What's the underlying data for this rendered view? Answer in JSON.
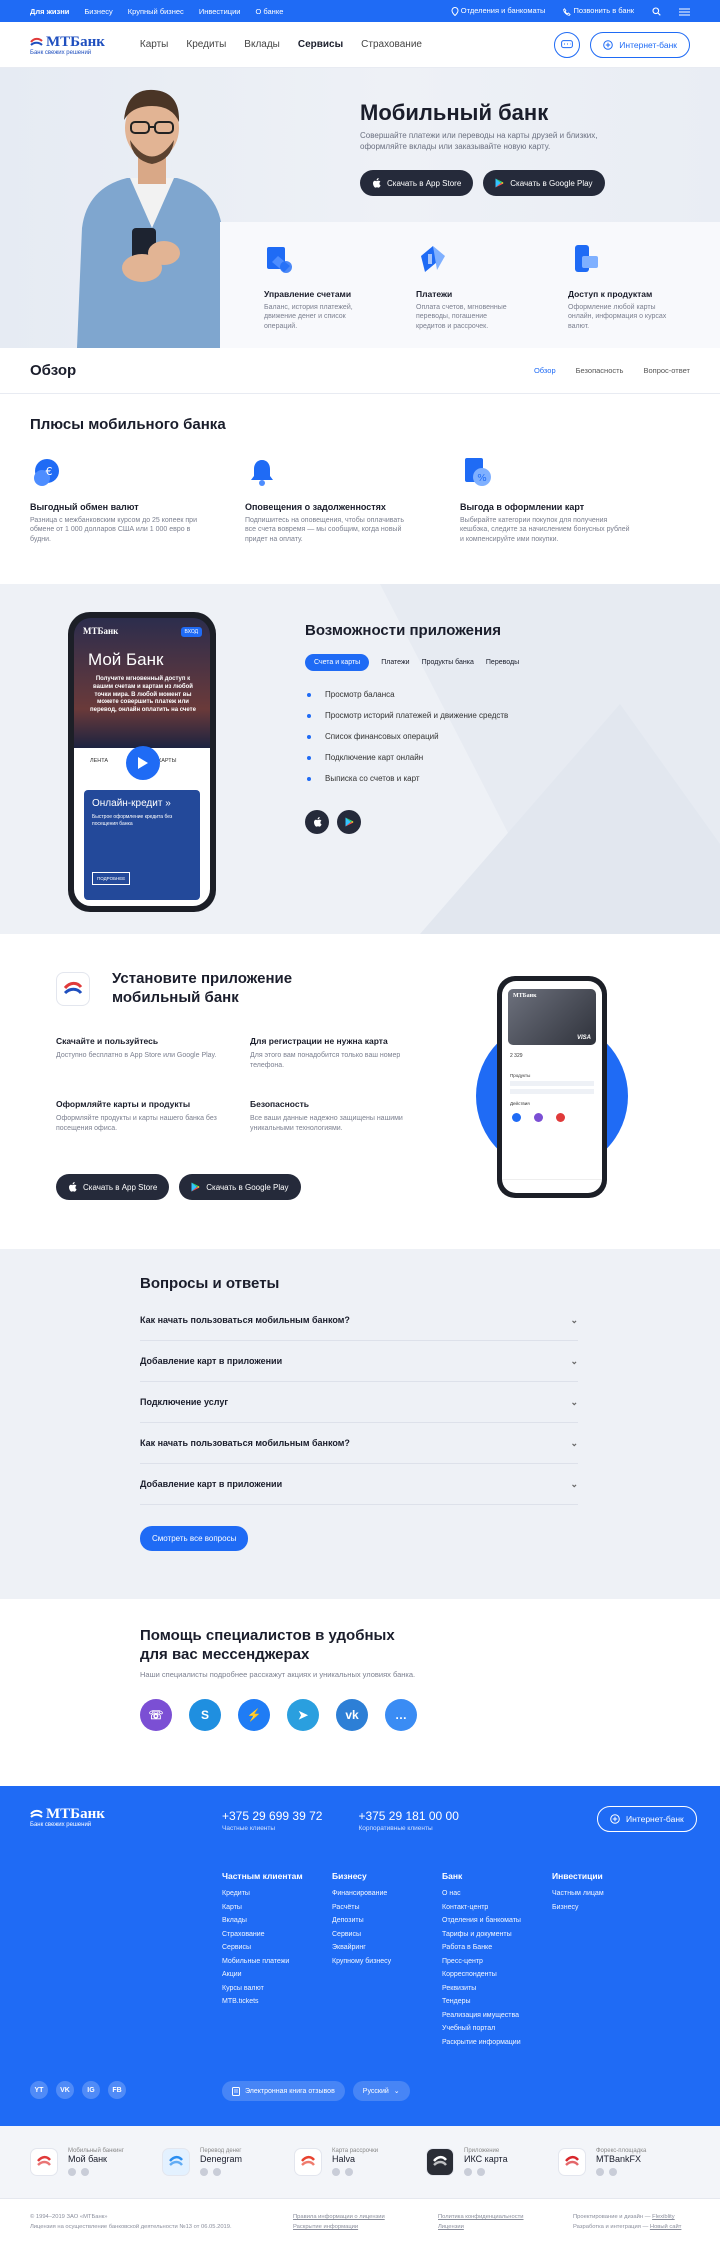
{
  "topbar": {
    "links": [
      "Для жизни",
      "Бизнесу",
      "Крупный бизнес",
      "Инвестиции",
      "О банке"
    ],
    "branches": "Отделения и банкоматы",
    "call": "Позвонить в банк"
  },
  "header": {
    "logo": "МТБанк",
    "tagline": "Банк свежих решений",
    "nav": [
      "Карты",
      "Кредиты",
      "Вклады",
      "Сервисы",
      "Страхование"
    ],
    "internet_bank": "Интернет-банк"
  },
  "hero": {
    "title": "Мобильный банк",
    "subtitle": "Совершайте платежи или переводы на карты друзей и близких, оформляйте вклады или заказывайте новую карту.",
    "app_store": "Скачать в App Store",
    "google_play": "Скачать в Google Play",
    "features": [
      {
        "title": "Управление счетами",
        "text": "Баланс, история платежей, движение денег и список операций."
      },
      {
        "title": "Платежи",
        "text": "Оплата счетов, мгновенные переводы, погашение кредитов и рассрочек."
      },
      {
        "title": "Доступ к продуктам",
        "text": "Оформление любой карты онлайн, информация о курсах валют."
      }
    ]
  },
  "overview": {
    "title": "Обзор",
    "tabs": [
      "Обзор",
      "Безопасность",
      "Вопрос-ответ"
    ]
  },
  "advantages": {
    "title": "Плюсы мобильного банка",
    "items": [
      {
        "title": "Выгодный обмен валют",
        "text": "Разница с межбанковским курсом до 25 копеек при обмене от 1 000 долларов США или 1 000 евро в будни."
      },
      {
        "title": "Оповещения о задолженностях",
        "text": "Подпишитесь на оповещения, чтобы оплачивать все счета вовремя — мы сообщим, когда новый придет на оплату."
      },
      {
        "title": "Выгода в оформлении карт",
        "text": "Выбирайте категории покупок для получения кешбэка, следите за начислением бонусных рублей и компенсируйте ими покупки."
      }
    ]
  },
  "app_features": {
    "title": "Возможности приложения",
    "chips": [
      "Счета и карты",
      "Платежи",
      "Продукты банка",
      "Переводы"
    ],
    "list": [
      "Просмотр баланса",
      "Просмотр историй платежей и движение средств",
      "Список финансовых операций",
      "Подключение карт онлайн",
      "Выписка  со счетов и карт"
    ],
    "phone": {
      "logo": "МТБанк",
      "entry": "ВХОД",
      "title": "Мой Банк",
      "text": "Получите мгновенный доступ к вашим счетам и картам из любой точки мира. В любой момент вы можете совершить платеж или перевод, онлайн оплатить на счете",
      "tab1": "ЛЕНТА",
      "tab2": "КАРТЫ",
      "card_title": "Онлайн-кредит »",
      "card_text": "Быстрое оформление кредита без посещения банка",
      "card_btn": "ПОДРОБНЕЕ"
    }
  },
  "install": {
    "title": "Установите приложение мобильный банк",
    "blocks": [
      {
        "title": "Скачайте и пользуйтесь",
        "text": "Доступно бесплатно в App Store или Google Play."
      },
      {
        "title": "Для регистрации не нужна карта",
        "text": "Для этого вам понадобится только ваш номер телефона."
      },
      {
        "title": "Оформляйте карты и продукты",
        "text": "Оформляйте продукты и карты нашего банка без посещения офиса."
      },
      {
        "title": "Безопасность",
        "text": "Все ваши данные надежно защищены нашими уникальными технологиями."
      }
    ],
    "app_store": "Скачать в App Store",
    "google_play": "Скачать в Google Play",
    "phone": {
      "logo": "МТБанк",
      "card_brand": "VISA",
      "balance": "2 329",
      "section1": "Продукты",
      "section2": "Действия"
    }
  },
  "faq": {
    "title": "Вопросы и ответы",
    "items": [
      "Как начать пользоваться мобильным банком?",
      "Добавление карт в приложении",
      "Подключение услуг",
      "Как начать пользоваться мобильным банком?",
      "Добавление карт в приложении"
    ],
    "all_button": "Смотреть все вопросы"
  },
  "messengers": {
    "title": "Помощь специалистов в удобных для вас мессенджерах",
    "text": "Наши специалисты подробнее расскажут акциях и уникальных уловиях банка.",
    "items": [
      {
        "name": "viber-icon",
        "color": "#7b4fd4",
        "glyph": "☏"
      },
      {
        "name": "skype-icon",
        "color": "#1f8fe0",
        "glyph": "S"
      },
      {
        "name": "messenger-icon",
        "color": "#1f7cf5",
        "glyph": "⚡"
      },
      {
        "name": "telegram-icon",
        "color": "#2a9fdf",
        "glyph": "➤"
      },
      {
        "name": "vk-icon",
        "color": "#2d7fd6",
        "glyph": "vk"
      },
      {
        "name": "chat-icon",
        "color": "#3a8cf4",
        "glyph": "…"
      }
    ]
  },
  "footer": {
    "logo": "МТБанк",
    "tagline": "Банк свежих решений",
    "phone1": "+375 29 699 39 72",
    "phone1_label": "Частные клиенты",
    "phone2": "+375 29 181 00 00",
    "phone2_label": "Корпоративные клиенты",
    "internet_bank": "Интернет-банк",
    "columns": [
      {
        "title": "Частным клиентам",
        "items": [
          "Кредиты",
          "Карты",
          "Вклады",
          "Страхование",
          "Сервисы",
          "Мобильные платежи",
          "Акции",
          "Курсы валют",
          "MTB.tickets"
        ]
      },
      {
        "title": "Бизнесу",
        "items": [
          "Финансирование",
          "Расчёты",
          "Депозиты",
          "Сервисы",
          "Эквайринг",
          "Крупному бизнесу"
        ]
      },
      {
        "title": "Банк",
        "items": [
          "О нас",
          "Контакт-центр",
          "Отделения и банкоматы",
          "Тарифы и документы",
          "Работа в Банке",
          "Пресс-центр",
          "Корреспонденты",
          "Реквизиты",
          "Тендеры",
          "Реализация имущества",
          "Учебный портал",
          "Раскрытие информации"
        ]
      },
      {
        "title": "Инвестиции",
        "items": [
          "Частным лицам",
          "Бизнесу"
        ]
      }
    ],
    "socials": [
      "YT",
      "VK",
      "IG",
      "FB"
    ],
    "feedback": "Электронная книга отзывов",
    "language": "Русский"
  },
  "apps": [
    {
      "label": "Мобильный банкинг",
      "name": "Мой банк",
      "color": "#e03a3a",
      "bg": "#ffffff"
    },
    {
      "label": "Перевод денег",
      "name": "Denegram",
      "color": "#2b8ef0",
      "bg": "#e3f1ff"
    },
    {
      "label": "Карта рассрочки",
      "name": "Halva",
      "color": "#e8432f",
      "bg": "#ffffff"
    },
    {
      "label": "Приложение",
      "name": "ИКС карта",
      "color": "#ffffff",
      "bg": "#2a2d36"
    },
    {
      "label": "Форекс-площадка",
      "name": "MTBankFX",
      "color": "#d8262b",
      "bg": "#ffffff"
    }
  ],
  "bottom": {
    "copyright": "© 1994–2019 ЗАО «МТБанк»",
    "license": "Лицензия на осуществление банковской деятельности №13 от 06.05.2019.",
    "links1": [
      "Правила информации о лицензии",
      "Раскрытие информации"
    ],
    "links2": [
      "Политика конфиденциальности",
      "Лицензии"
    ],
    "dev": "Проектирование и дизайн — ",
    "dev_link": "Flexiblity",
    "dev2": "Разработка и интеграция — ",
    "dev2_link": "Новый сайт"
  }
}
